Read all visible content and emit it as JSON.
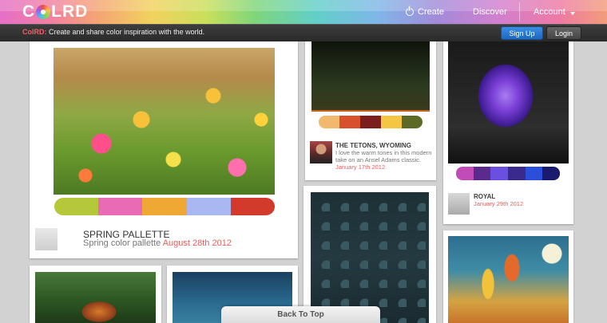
{
  "header": {
    "logo_text": "COLRD",
    "nav": {
      "create": "Create",
      "discover": "Discover",
      "account": "Account"
    }
  },
  "subbar": {
    "brand": "ColRD:",
    "tagline": "Create and share color inspiration with the world.",
    "signup_label": "Sign Up",
    "login_label": "Login"
  },
  "cards": [
    {
      "title": "SPRING PALLETTE",
      "description": "Spring color pallette",
      "date": "August 28th 2012",
      "swatches": [
        "#b5c83a",
        "#ea6bb5",
        "#f0a834",
        "#a9b8f2",
        "#d23a2c"
      ]
    },
    {
      "title": "THE TETONS, WYOMING",
      "description": "I love the warm tones in this modern take on an Ansel Adams classic.",
      "date": "January 17th 2012",
      "swatches": [
        "#f2b86d",
        "#d8502c",
        "#7a1e1e",
        "#f3c744",
        "#5c6a28"
      ]
    },
    {
      "title": "ROYAL",
      "description": "",
      "date": "January 29th 2012",
      "swatches": [
        "#c34bb8",
        "#5a2a8c",
        "#6b4fe0",
        "#3a2a8e",
        "#2c4fd9",
        "#1a1a6e"
      ]
    }
  ],
  "back_to_top": "Back To Top",
  "colors": {
    "accent_date": "#e06060",
    "signup_blue": "#1e68c2"
  }
}
